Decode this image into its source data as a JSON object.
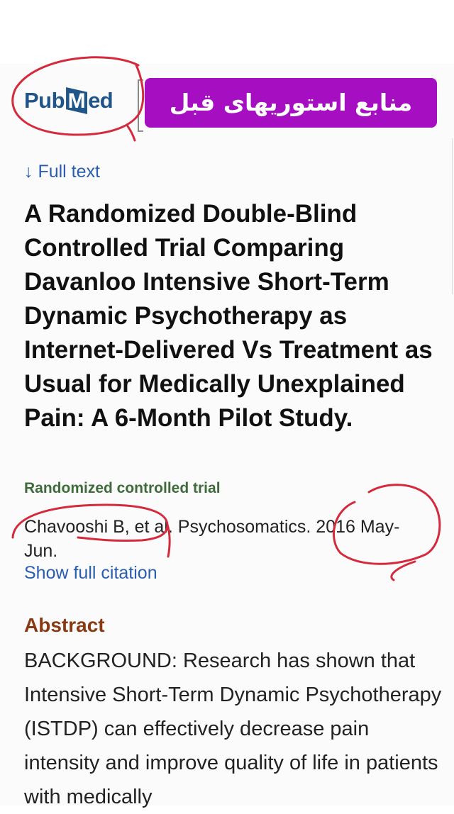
{
  "logo": {
    "pub": "Pub",
    "m": "M",
    "ed": "ed"
  },
  "banner": {
    "text": "منابع استوریهای قبل",
    "color": "#a60fc1"
  },
  "full_text_link": "↓ Full text",
  "article": {
    "title": "A Randomized Double-Blind Controlled Trial Comparing Davanloo Intensive Short-Term Dynamic Psychotherapy as Internet-Delivered Vs Treatment as Usual for Medically Unexplained Pain: A 6-Month Pilot Study.",
    "publication_type": "Randomized controlled trial",
    "citation": "Chavooshi B, et al. Psychosomatics. 2016 May-Jun.",
    "show_full_citation": "Show full citation",
    "abstract_heading": "Abstract",
    "abstract_text": "BACKGROUND: Research has shown that Intensive Short-Term Dynamic Psychotherapy (ISTDP) can effectively decrease pain intensity and improve quality of life in patients with medically"
  },
  "colors": {
    "link": "#2a5db0",
    "annotation": "#d42a3c",
    "logo": "#20558a"
  }
}
